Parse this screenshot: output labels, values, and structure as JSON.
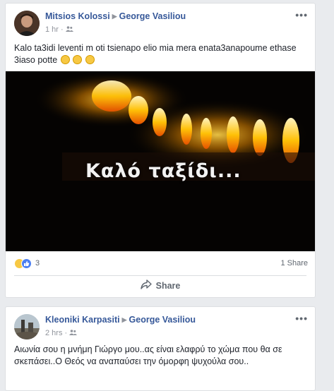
{
  "posts": [
    {
      "author": "Mitsios Kolossi",
      "recipient": "George Vasiliou",
      "time": "1 hr",
      "separator": "·",
      "more": "•••",
      "text": "Kalo ta3idi leventi m oti tsienapo elio mia mera enata3anapoume ethase 3iaso potte",
      "emoji_icons": [
        "sad-face-icon",
        "crying-face-icon",
        "loudly-crying-face-icon"
      ],
      "photo_caption": "Καλό ταξίδι...",
      "reaction_icons": [
        "sad-reaction-icon",
        "like-reaction-icon"
      ],
      "reaction_count": "3",
      "shares": "1 Share",
      "share_label": "Share"
    },
    {
      "author": "Kleoniki Karpasiti",
      "recipient": "George Vasiliou",
      "time": "2 hrs",
      "separator": "·",
      "more": "•••",
      "text": "Αιωνία σου η μνήμη Γιώργο μου..ας είναι ελαφρύ το χώμα που θα σε σκεπάσει..Ο Θεός να αναπαύσει την όμορφη ψυχούλα σου.."
    }
  ],
  "colors": {
    "page_bg": "#e9ebee",
    "link": "#365899",
    "meta": "#90949c",
    "like": "#4c7ff1",
    "flame": "#ffb300"
  }
}
